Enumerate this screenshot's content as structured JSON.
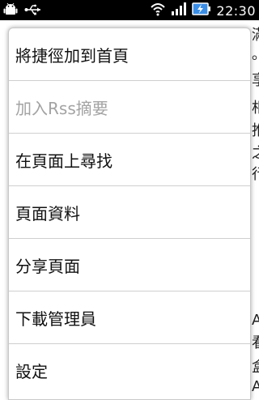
{
  "status_bar": {
    "time": "22:30",
    "icons": [
      "android-debug-icon",
      "usb-icon",
      "wifi-icon",
      "signal-icon",
      "battery-charging-icon"
    ]
  },
  "background_page": {
    "fragments": [
      "滿",
      "。",
      "享",
      "相",
      "推",
      "之",
      "行",
      "A",
      "看",
      "盒",
      "A"
    ]
  },
  "menu": {
    "items": [
      {
        "label": "將捷徑加到首頁",
        "enabled": true
      },
      {
        "label": "加入Rss摘要",
        "enabled": false
      },
      {
        "label": "在頁面上尋找",
        "enabled": true
      },
      {
        "label": "頁面資料",
        "enabled": true
      },
      {
        "label": "分享頁面",
        "enabled": true
      },
      {
        "label": "下載管理員",
        "enabled": true
      },
      {
        "label": "設定",
        "enabled": true
      }
    ]
  }
}
